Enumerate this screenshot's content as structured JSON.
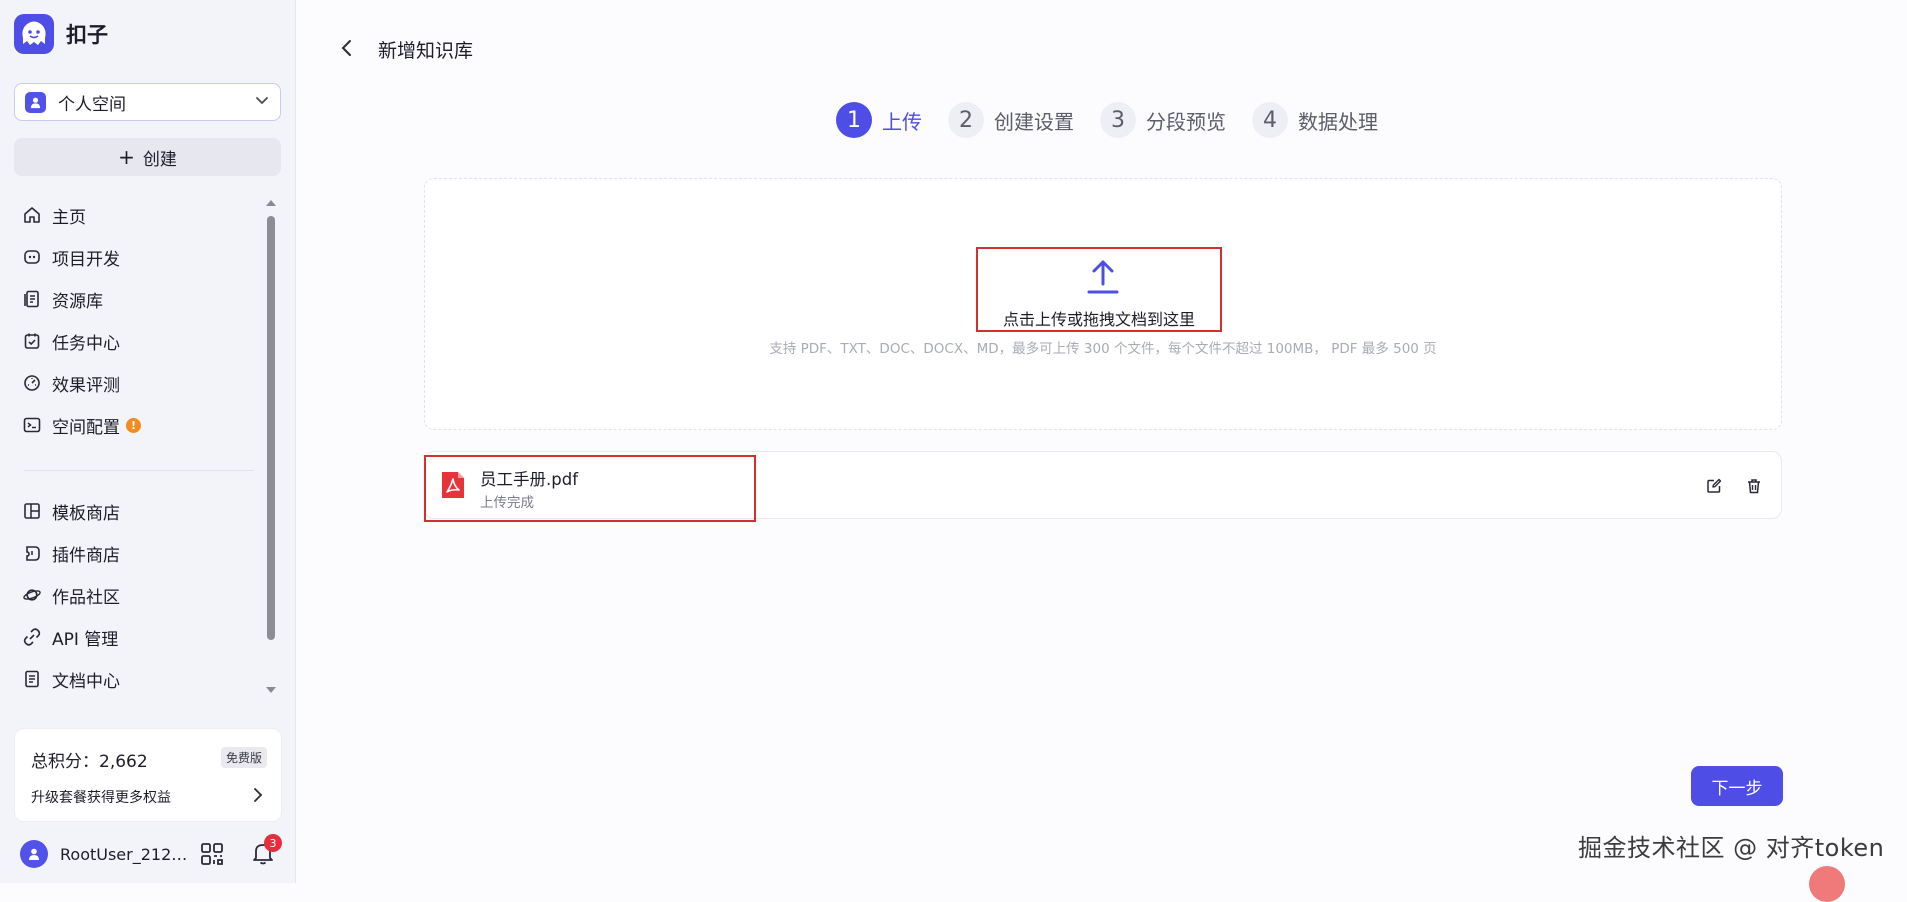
{
  "app": {
    "name": "扣子"
  },
  "sidebar": {
    "space_selector": {
      "label": "个人空间"
    },
    "create_button": {
      "label": "创建",
      "icon": "plus"
    },
    "nav_items": [
      {
        "label": "主页",
        "icon": "home-icon"
      },
      {
        "label": "项目开发",
        "icon": "bot-icon"
      },
      {
        "label": "资源库",
        "icon": "library-icon"
      },
      {
        "label": "任务中心",
        "icon": "task-icon"
      },
      {
        "label": "效果评测",
        "icon": "gauge-icon"
      },
      {
        "label": "空间配置",
        "icon": "terminal-icon",
        "badge": "!"
      }
    ],
    "nav_items_secondary": [
      {
        "label": "模板商店",
        "icon": "template-icon"
      },
      {
        "label": "插件商店",
        "icon": "plugin-icon"
      },
      {
        "label": "作品社区",
        "icon": "planet-icon"
      },
      {
        "label": "API 管理",
        "icon": "api-icon"
      },
      {
        "label": "文档中心",
        "icon": "doc-icon"
      }
    ],
    "points": {
      "text": "总积分：2,662",
      "plan_badge": "免费版",
      "upgrade_text": "升级套餐获得更多权益"
    },
    "user": {
      "name": "RootUser_212…",
      "notifications_count": "3"
    }
  },
  "page": {
    "title": "新增知识库"
  },
  "steps": [
    {
      "number": "1",
      "label": "上传",
      "active": true
    },
    {
      "number": "2",
      "label": "创建设置",
      "active": false
    },
    {
      "number": "3",
      "label": "分段预览",
      "active": false
    },
    {
      "number": "4",
      "label": "数据处理",
      "active": false
    }
  ],
  "upload": {
    "title": "点击上传或拖拽文档到这里",
    "hint": "支持 PDF、TXT、DOC、DOCX、MD，最多可上传 300 个文件，每个文件不超过 100MB， PDF 最多 500 页"
  },
  "files": [
    {
      "name": "员工手册.pdf",
      "status": "上传完成"
    }
  ],
  "actions": {
    "next_label": "下一步"
  },
  "watermark": "掘金技术社区 @ 对齐token",
  "colors": {
    "accent": "#4e4ee6",
    "highlight": "#d32f2f",
    "pdf_red": "#e5343a",
    "warning": "#f28c1e"
  }
}
